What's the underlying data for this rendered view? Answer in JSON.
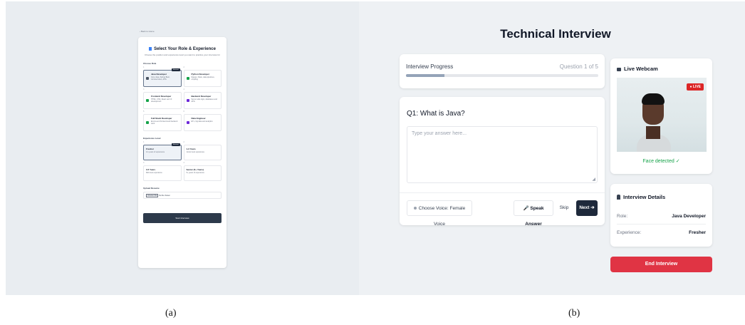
{
  "panel_a": {
    "back_link": "‹ Back to Home",
    "title": "Select Your Role & Experience",
    "subtitle": "Choose the position and experience level you want to practice your interview for",
    "role_section": "Choose Role",
    "roles": [
      {
        "index": "1",
        "title": "Java Developer",
        "desc": "Core Java, Spring Boot, microservices, APIs",
        "selected": true,
        "badge": "Selected",
        "color": "#4b5563"
      },
      {
        "index": "2",
        "title": "Python Developer",
        "desc": "Django, Flask, data pipelines, scripting",
        "selected": false,
        "color": "#16a34a"
      },
      {
        "index": "3",
        "title": "Frontend Developer",
        "desc": "HTML, CSS, React and UI development",
        "selected": false,
        "color": "#16a34a"
      },
      {
        "index": "4",
        "title": "Backend Developer",
        "desc": "Server-side logic, databases and APIs",
        "selected": false,
        "color": "#6d28d9"
      },
      {
        "index": "5",
        "title": "Full Stack Developer",
        "desc": "End-to-end frontend and backend work",
        "selected": false,
        "color": "#16a34a"
      },
      {
        "index": "6",
        "title": "Data Engineer",
        "desc": "ETL, big data and analytics",
        "selected": false,
        "color": "#6d28d9"
      }
    ],
    "experience_section": "Experience Level",
    "experience": [
      {
        "index": "1",
        "title": "Fresher",
        "desc": "0-1 years of experience",
        "selected": true,
        "badge": "Selected"
      },
      {
        "index": "2",
        "title": "1-3 Years",
        "desc": "Junior level experience",
        "selected": false
      },
      {
        "index": "3",
        "title": "3-5 Years",
        "desc": "Mid level experience",
        "selected": false
      },
      {
        "index": "4",
        "title": "Senior (5+ Years)",
        "desc": "5+ years of experience",
        "selected": false
      }
    ],
    "upload_section": "Upload Resume",
    "upload_button": "Choose File",
    "upload_status": "No file chosen",
    "start_button": "Start Interview"
  },
  "panel_b": {
    "title": "Technical Interview",
    "progress_label": "Interview Progress",
    "progress_count": "Question 1 of 5",
    "progress_fraction": 0.2,
    "question": "Q1: What is Java?",
    "answer_placeholder": "Type your answer here...",
    "voice_button": "Choose Voice: Female Voice",
    "speak_button": "🎤 Speak Answer",
    "skip_button": "Skip",
    "next_button": "Next ➔",
    "webcam_title": "Live Webcam",
    "live_badge": "● LIVE",
    "face_status": "Face detected ✓",
    "details_title": "Interview Details",
    "role_key": "Role:",
    "role_value": "Java Developer",
    "experience_key": "Experience:",
    "experience_value": "Fresher",
    "end_button": "End Interview"
  },
  "captions": {
    "a": "(a)",
    "b": "(b)"
  }
}
